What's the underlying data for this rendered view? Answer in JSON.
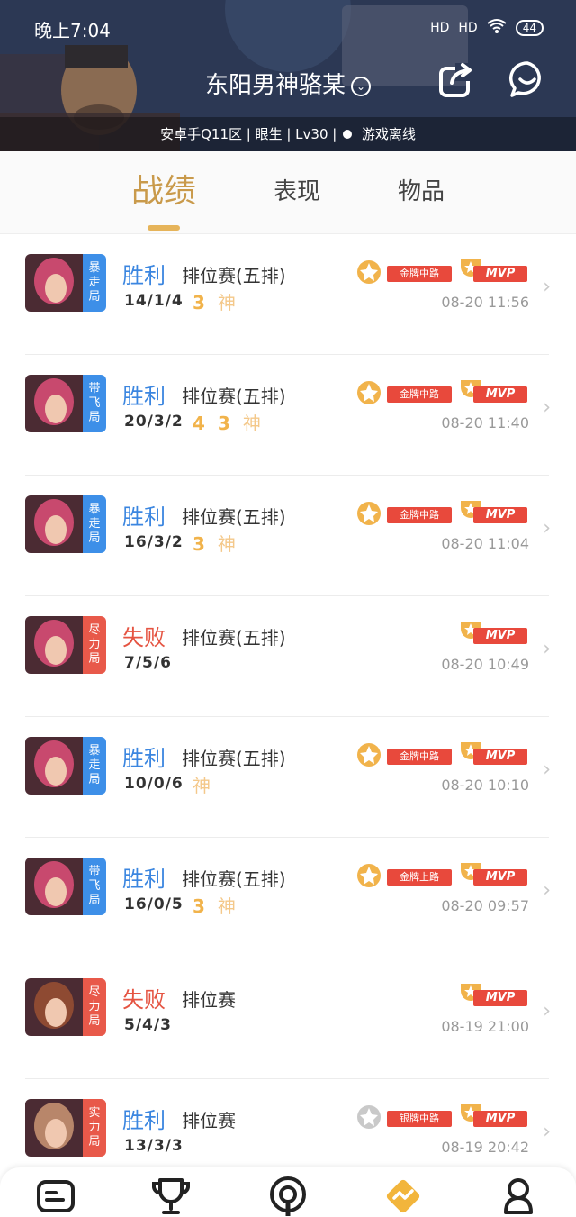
{
  "status_bar": {
    "time": "晚上7:04",
    "signal_1": "HD",
    "signal_2": "HD",
    "battery": "44"
  },
  "profile": {
    "name": "东阳男神骆某",
    "info": "安卓手Q11区 | 眼生 | Lv30 |",
    "game_status": "游戏离线"
  },
  "tabs": [
    {
      "label": "战绩",
      "active": true
    },
    {
      "label": "表现",
      "active": false
    },
    {
      "label": "物品",
      "active": false
    }
  ],
  "matches": [
    {
      "tag": "暴走局",
      "tag_color": "#3d8fe8",
      "result": "胜利",
      "win": true,
      "mode": "排位赛(五排)",
      "kda": "14/1/4",
      "badges": [
        "3",
        "神"
      ],
      "medal": "金牌中路",
      "mvp": "MVP",
      "time": "08-20 11:56"
    },
    {
      "tag": "带飞局",
      "tag_color": "#3d8fe8",
      "result": "胜利",
      "win": true,
      "mode": "排位赛(五排)",
      "kda": "20/3/2",
      "badges": [
        "4",
        "3",
        "神"
      ],
      "medal": "金牌中路",
      "mvp": "MVP",
      "time": "08-20 11:40"
    },
    {
      "tag": "暴走局",
      "tag_color": "#3d8fe8",
      "result": "胜利",
      "win": true,
      "mode": "排位赛(五排)",
      "kda": "16/3/2",
      "badges": [
        "3",
        "神"
      ],
      "medal": "金牌中路",
      "mvp": "MVP",
      "time": "08-20 11:04"
    },
    {
      "tag": "尽力局",
      "tag_color": "#e8594a",
      "result": "失败",
      "win": false,
      "mode": "排位赛(五排)",
      "kda": "7/5/6",
      "badges": [],
      "medal": "",
      "mvp": "MVP",
      "time": "08-20 10:49"
    },
    {
      "tag": "暴走局",
      "tag_color": "#3d8fe8",
      "result": "胜利",
      "win": true,
      "mode": "排位赛(五排)",
      "kda": "10/0/6",
      "badges": [
        "神"
      ],
      "medal": "金牌中路",
      "mvp": "MVP",
      "time": "08-20 10:10"
    },
    {
      "tag": "带飞局",
      "tag_color": "#3d8fe8",
      "result": "胜利",
      "win": true,
      "mode": "排位赛(五排)",
      "kda": "16/0/5",
      "badges": [
        "3",
        "神"
      ],
      "medal": "金牌上路",
      "mvp": "MVP",
      "time": "08-20 09:57"
    },
    {
      "tag": "尽力局",
      "tag_color": "#e8594a",
      "result": "失败",
      "win": false,
      "mode": "排位赛",
      "kda": "5/4/3",
      "badges": [],
      "medal": "",
      "mvp": "MVP",
      "time": "08-19 21:00"
    },
    {
      "tag": "实力局",
      "tag_color": "#e8594a",
      "result": "胜利",
      "win": true,
      "mode": "排位赛",
      "kda": "13/3/3",
      "badges": [],
      "medal": "银牌中路",
      "mvp": "MVP",
      "time": "08-19 20:42"
    }
  ],
  "bottom_nav": [
    {
      "icon": "list-icon",
      "active": false
    },
    {
      "icon": "trophy-icon",
      "active": false
    },
    {
      "icon": "podcast-icon",
      "active": false
    },
    {
      "icon": "trend-icon",
      "active": true
    },
    {
      "icon": "user-icon",
      "active": false
    }
  ],
  "colors": {
    "accent": "#c99a4b",
    "win": "#3b86e0",
    "lose": "#e55442",
    "nav_active": "#f2b53c"
  }
}
